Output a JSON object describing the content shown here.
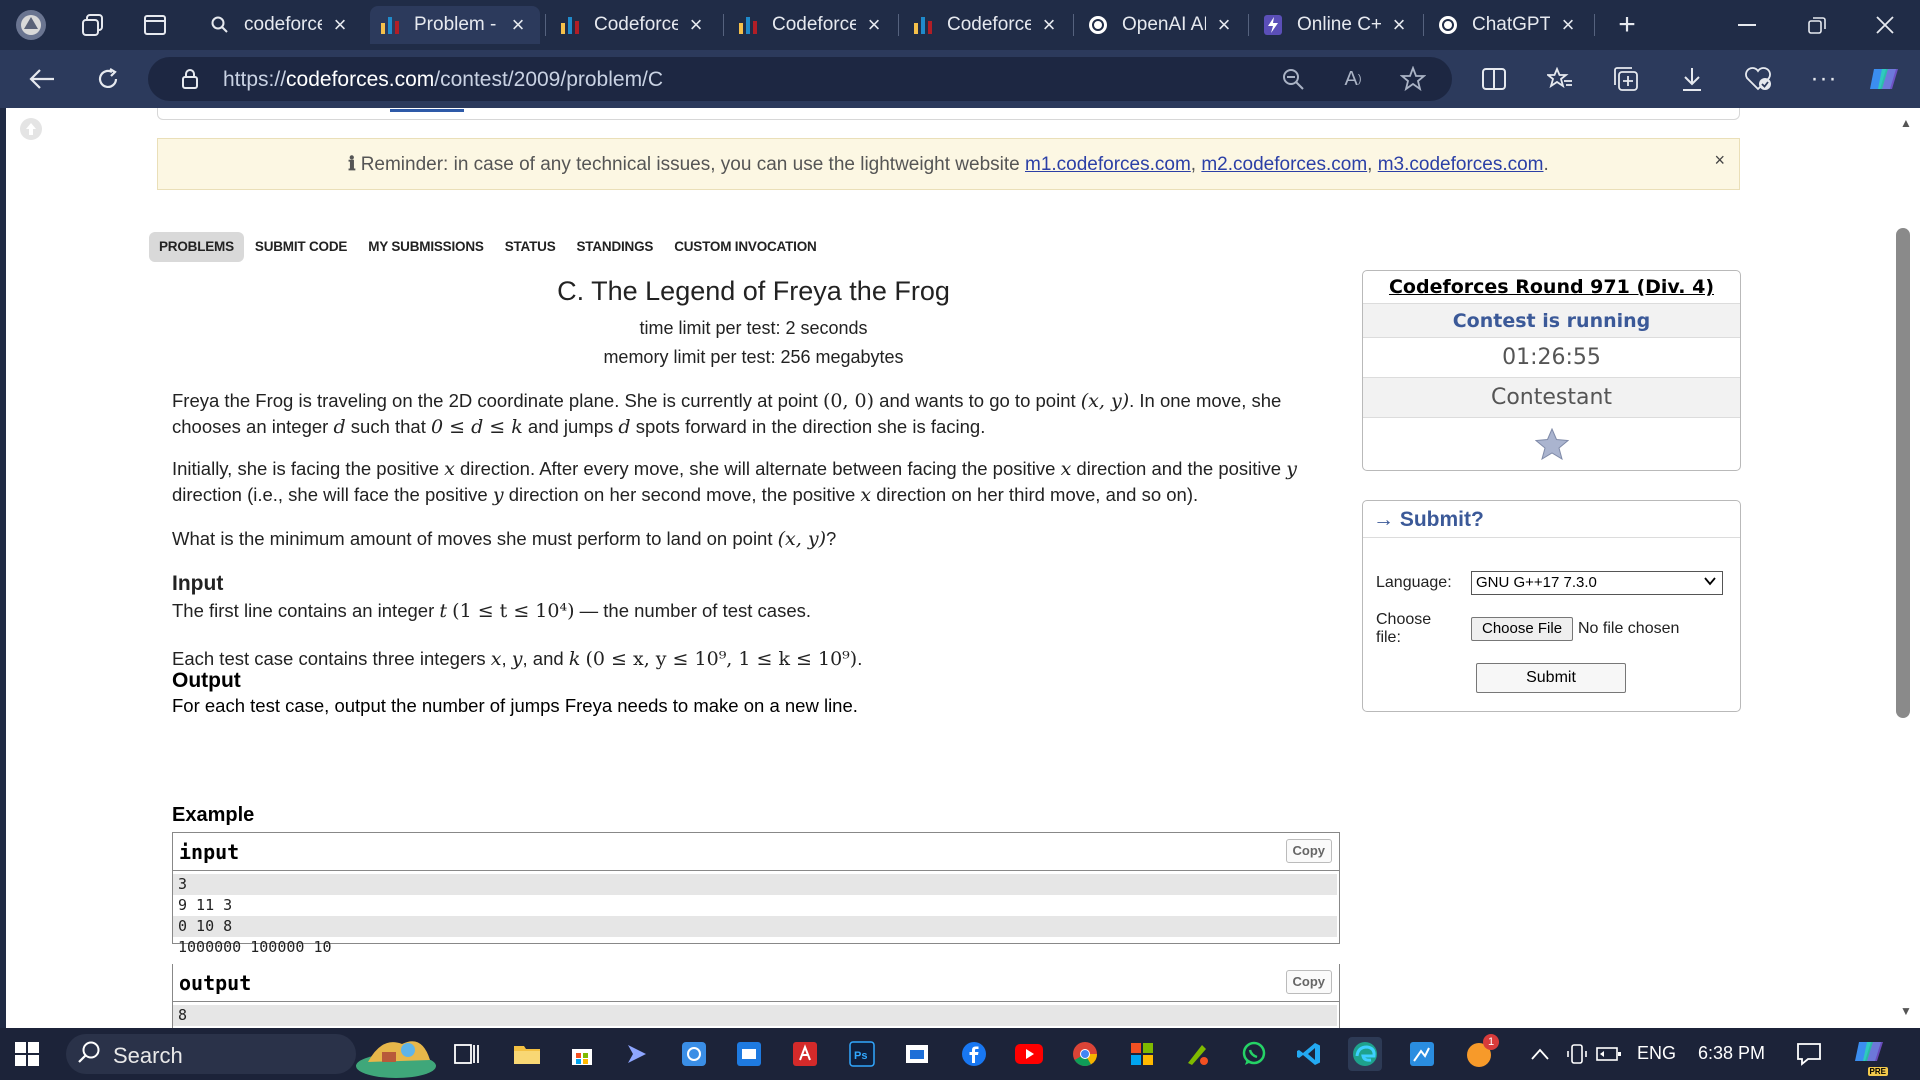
{
  "browser": {
    "tabs": [
      {
        "label": "codeforces",
        "icon": "search-icon",
        "active": false
      },
      {
        "label": "Problem - ",
        "icon": "codeforces-logo",
        "active": true
      },
      {
        "label": "Codeforces",
        "icon": "codeforces-logo",
        "active": false
      },
      {
        "label": "Codeforces",
        "icon": "codeforces-logo",
        "active": false
      },
      {
        "label": "Codeforces",
        "icon": "codeforces-logo",
        "active": false
      },
      {
        "label": "OpenAI AP",
        "icon": "openai-logo",
        "active": false
      },
      {
        "label": "Online C+",
        "icon": "bolt-icon",
        "active": false
      },
      {
        "label": "ChatGPT",
        "icon": "openai-logo",
        "active": false
      }
    ],
    "url_scheme": "https://",
    "url_host": "codeforces.com",
    "url_path": "/contest/2009/problem/C"
  },
  "page": {
    "reminder": {
      "prefix": "Reminder: in case of any technical issues, you can use the lightweight website",
      "links": [
        "m1.codeforces.com",
        "m2.codeforces.com",
        "m3.codeforces.com"
      ],
      "sep": ",",
      "suffix": ".",
      "close": "×"
    },
    "nav": [
      "Problems",
      "Submit Code",
      "My Submissions",
      "Status",
      "Standings",
      "Custom Invocation"
    ],
    "problem": {
      "title": "C. The Legend of Freya the Frog",
      "time_limit": "time limit per test: 2 seconds",
      "memory_limit": "memory limit per test: 256 megabytes",
      "statement": {
        "p1a": "Freya the Frog is traveling on the 2D coordinate plane. She is currently at point ",
        "p1b": " and wants to go to point ",
        "p1c": ". In one move, she chooses an integer ",
        "p1d": " such that ",
        "p1e": " and jumps ",
        "p1f": " spots forward in the direction she is facing.",
        "p2a": "Initially, she is facing the positive ",
        "p2b": " direction. After every move, she will alternate between facing the positive ",
        "p2c": " direction and the positive ",
        "p2d": " direction (i.e., she will face the positive ",
        "p2e": " direction on her second move, the positive ",
        "p2f": " direction on her third move, and so on).",
        "p3a": "What is the minimum amount of moves she must perform to land on point ",
        "p3b": "?"
      },
      "math": {
        "origin": "(0, 0)",
        "target": "(x, y)",
        "d": "d",
        "drange": "0 ≤ d ≤ k",
        "x": "x",
        "y": "y",
        "t": "t",
        "trange": "(1 ≤ t ≤ 10⁴)",
        "constraint": "(0 ≤ x, y ≤ 10⁹, 1 ≤ k ≤ 10⁹)"
      },
      "input_head": "Input",
      "input_text1a": "The first line contains an integer ",
      "input_text1b": " — the number of test cases.",
      "input_text2a": "Each test case contains three integers ",
      "input_text2b": ", ",
      "input_text2c": ", and ",
      "input_text2d": ".",
      "k": "k",
      "output_head": "Output",
      "output_text": "For each test case, output the number of jumps Freya needs to make on a new line.",
      "example_head": "Example",
      "sample_input_label": "input",
      "sample_output_label": "output",
      "copy": "Copy",
      "sample_input": [
        "3",
        "9 11 3",
        "0 10 8",
        "1000000 100000 10"
      ],
      "sample_output": [
        "8"
      ]
    },
    "sidebar": {
      "round": "Codeforces Round 971 (Div. 4)",
      "status": "Contest is running",
      "timer": "01:26:55",
      "role": "Contestant",
      "submit_title": "→ Submit?",
      "language_label": "Language:",
      "language_value": "GNU G++17 7.3.0",
      "file_label": "Choose file:",
      "choose_file": "Choose File",
      "no_file": "No file chosen",
      "submit": "Submit"
    }
  },
  "taskbar": {
    "search": "Search",
    "lang": "ENG",
    "time": "6:38 PM",
    "notify_count": "1",
    "copilot_badge": "PRE"
  }
}
